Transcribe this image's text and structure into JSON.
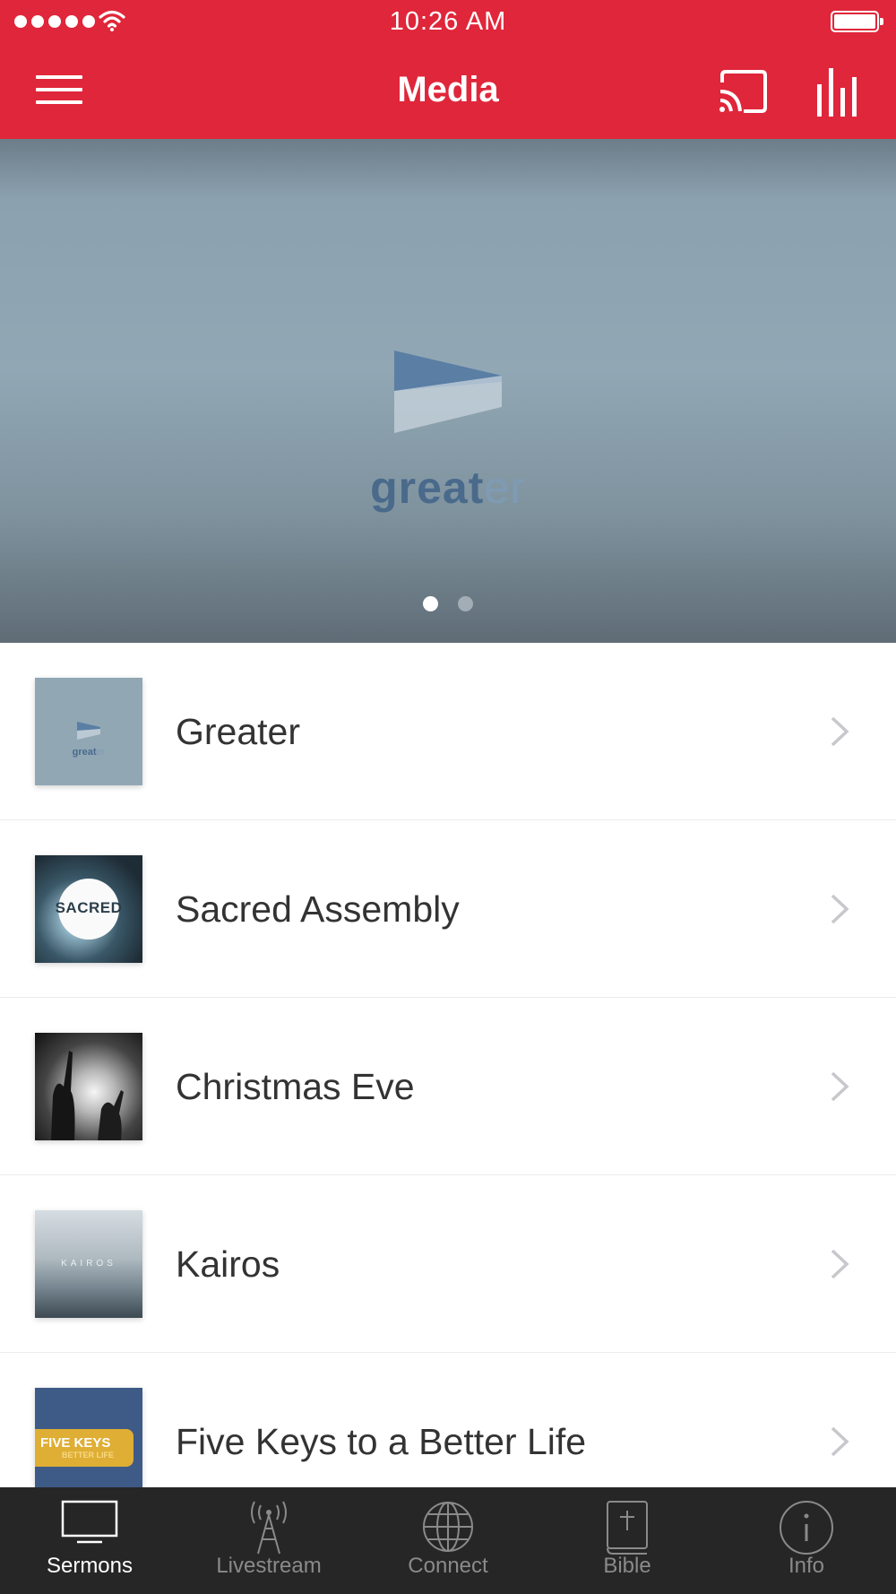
{
  "status_bar": {
    "time": "10:26 AM",
    "signal_dots": 5,
    "wifi_icon": "wifi-icon",
    "battery_icon": "battery-icon",
    "battery_level": 1.0
  },
  "nav": {
    "title": "Media",
    "menu_icon": "hamburger-menu-icon",
    "cast_icon": "cast-icon",
    "stats_icon": "bar-chart-icon"
  },
  "hero": {
    "logo_word_main": "great",
    "logo_word_tail": "er",
    "page_count": 2,
    "active_page": 1
  },
  "sermon_series": [
    {
      "title": "Greater",
      "thumb": {
        "main": "great",
        "tail": "er"
      }
    },
    {
      "title": "Sacred Assembly",
      "thumb": {
        "label": "SACRED"
      }
    },
    {
      "title": "Christmas Eve"
    },
    {
      "title": "Kairos",
      "thumb": {
        "label": "KAIROS"
      }
    },
    {
      "title": "Five Keys to a Better Life",
      "thumb": {
        "label": "FIVE KEYS",
        "sublabel": "BETTER LIFE"
      }
    }
  ],
  "tabs": [
    {
      "label": "Sermons",
      "icon": "tv-icon",
      "active": true
    },
    {
      "label": "Livestream",
      "icon": "antenna-icon",
      "active": false
    },
    {
      "label": "Connect",
      "icon": "globe-icon",
      "active": false
    },
    {
      "label": "Bible",
      "icon": "bible-icon",
      "active": false
    },
    {
      "label": "Info",
      "icon": "info-icon",
      "active": false
    }
  ],
  "colors": {
    "brand_red": "#e0263a",
    "tab_bar_bg": "#262626",
    "tab_active": "#ffffff",
    "tab_inactive": "#8a8a8a",
    "chevron": "#c7c7cc"
  }
}
